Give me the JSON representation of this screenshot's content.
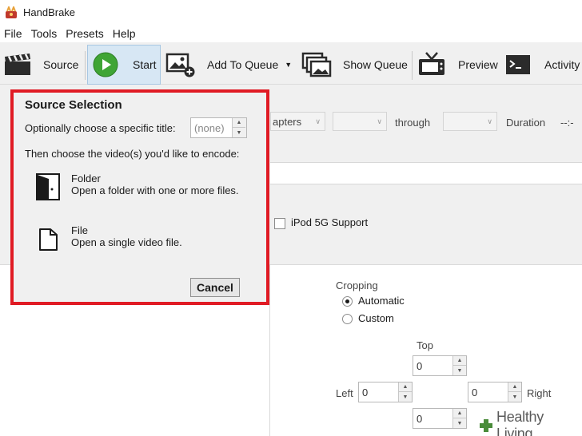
{
  "window": {
    "title": "HandBrake"
  },
  "menu": [
    "File",
    "Tools",
    "Presets",
    "Help"
  ],
  "toolbar": {
    "source": "Source",
    "start": "Start",
    "add_to_queue": "Add To Queue",
    "show_queue": "Show Queue",
    "preview": "Preview",
    "activity": "Activity"
  },
  "background": {
    "chapters_combo": "apters",
    "through": "through",
    "duration": "Duration",
    "duration_value": "--:-",
    "ipod_support": "iPod 5G Support",
    "cropping": {
      "heading": "Cropping",
      "automatic": "Automatic",
      "custom": "Custom",
      "selected": "Automatic",
      "top_label": "Top",
      "left_label": "Left",
      "right_label": "Right",
      "top": "0",
      "left": "0",
      "right": "0",
      "bottom": "0"
    }
  },
  "source_selection": {
    "title": "Source Selection",
    "choose_title_prompt": "Optionally choose a specific title:",
    "title_value": "(none)",
    "choose_video_prompt": "Then choose the video(s) you'd like to encode:",
    "folder": {
      "name": "Folder",
      "description": "Open a folder with one or more files."
    },
    "file": {
      "name": "File",
      "description": "Open a single video file."
    },
    "cancel": "Cancel"
  },
  "watermark": "Healthy Living",
  "colors": {
    "highlight_border": "#e01b24",
    "start_button_bg": "#d7e7f4",
    "play_icon": "#3fa535",
    "watermark_plus": "#4a8c3a"
  }
}
